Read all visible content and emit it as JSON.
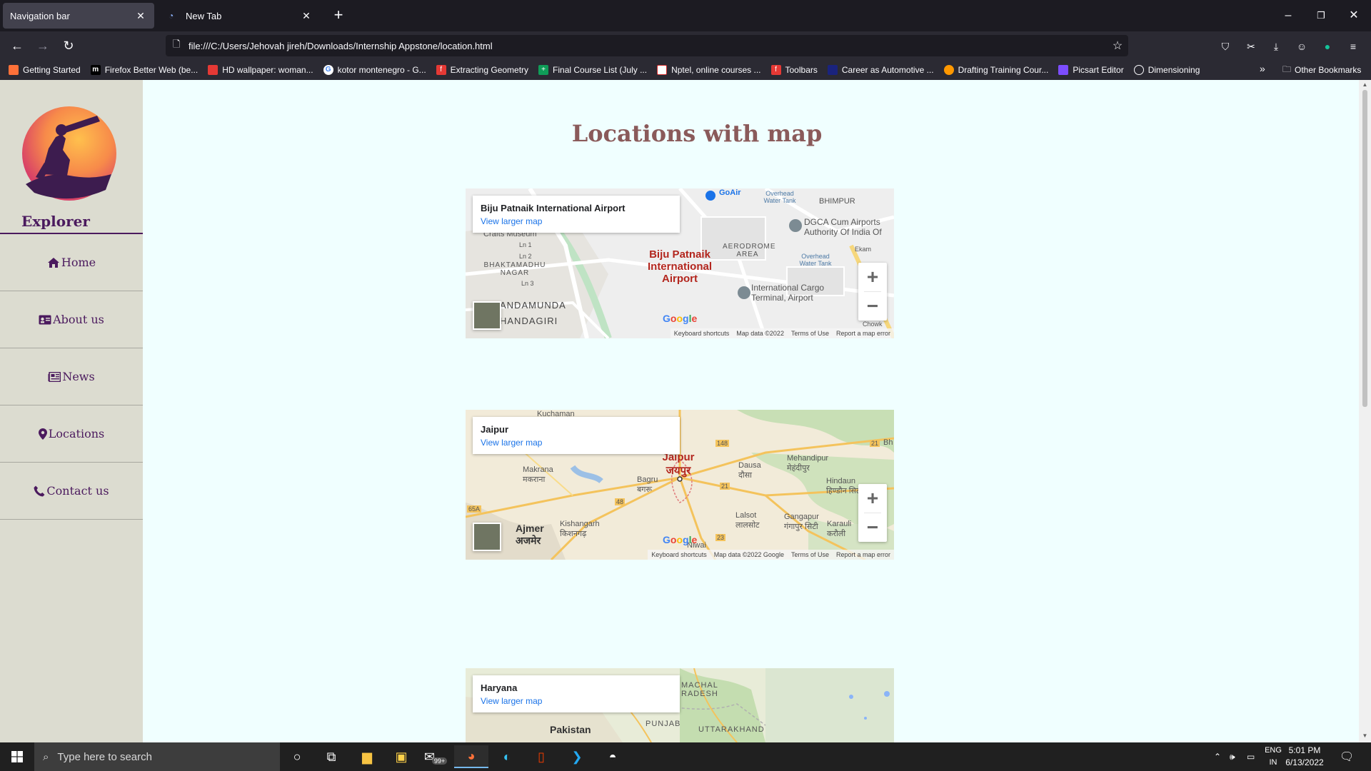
{
  "browser": {
    "tabs": [
      {
        "title": "Navigation bar",
        "active": true
      },
      {
        "title": "New Tab",
        "active": false
      }
    ],
    "url": "file:///C:/Users/Jehovah jireh/Downloads/Internship Appstone/location.html",
    "bookmarks": [
      {
        "label": "Getting Started",
        "color": "#ff7139"
      },
      {
        "label": "Firefox Better Web (be...",
        "color": "#000000"
      },
      {
        "label": "HD wallpaper: woman...",
        "color": "#e53935"
      },
      {
        "label": "kotor montenegro - G...",
        "color": "#4285f4"
      },
      {
        "label": "Extracting Geometry",
        "color": "#e53935"
      },
      {
        "label": "Final Course List (July ...",
        "color": "#0f9d58"
      },
      {
        "label": "Nptel, online courses ...",
        "color": "#d32f2f"
      },
      {
        "label": "Toolbars",
        "color": "#e53935"
      },
      {
        "label": "Career as Automotive ...",
        "color": "#1a237e"
      },
      {
        "label": "Drafting Training Cour...",
        "color": "#ff9800"
      },
      {
        "label": "Picsart Editor",
        "color": "#7c4dff"
      },
      {
        "label": "Dimensioning",
        "color": "#9e9e9e"
      }
    ],
    "other_bookmarks": "Other Bookmarks"
  },
  "sidebar": {
    "brand": "Explorer",
    "items": [
      {
        "label": "Home",
        "icon": "home-icon"
      },
      {
        "label": "About us",
        "icon": "id-card-icon"
      },
      {
        "label": "News",
        "icon": "newspaper-icon"
      },
      {
        "label": "Locations",
        "icon": "map-pin-icon"
      },
      {
        "label": "Contact us",
        "icon": "phone-icon"
      }
    ]
  },
  "page": {
    "title": "Locations with map"
  },
  "maps": [
    {
      "place": "Biju Patnaik International Airport",
      "larger_link": "View larger map",
      "labels": [
        "GoAir",
        "Overhead Water Tank",
        "BHIMPUR",
        "DGCA Cum Airports Authority Of India Of",
        "Crafts Museum",
        "Ln 1",
        "Ln 2",
        "Ln 3",
        "BHAKTAMADHU NAGAR",
        "AERODROME AREA",
        "Overhead Water Tank",
        "Ekam",
        "International Cargo Terminal, Airport",
        "ANDAMUNDA",
        "HANDAGIRI",
        "Chowk"
      ],
      "pin_label": "Biju Patnaik International Airport",
      "attribution": [
        "Keyboard shortcuts",
        "Map data ©2022",
        "Terms of Use",
        "Report a map error"
      ]
    },
    {
      "place": "Jaipur",
      "larger_link": "View larger map",
      "labels": [
        "Kuchaman",
        "Makrana मकराना",
        "Bagru बगरू",
        "Dausa दौसा",
        "Mehandipur मेहंदीपुर",
        "Hindaun हिण्डौन सिटी",
        "Lalsot लालसोट",
        "Gangapur गंगापुर सिटी",
        "Karauli करौली",
        "Kishangarh किशनगढ़",
        "Ajmer अजमेर",
        "Niwai",
        "Bh"
      ],
      "roads": [
        "148",
        "21",
        "21",
        "48",
        "65A",
        "23"
      ],
      "pin_label": "Jaipur जयपुर",
      "attribution": [
        "Keyboard shortcuts",
        "Map data ©2022 Google",
        "Terms of Use",
        "Report a map error"
      ]
    },
    {
      "place": "Haryana",
      "larger_link": "View larger map",
      "labels": [
        "MACHAL RADESH",
        "Pakistan",
        "PUNJAB",
        "UTTARAKHAND"
      ]
    }
  ],
  "taskbar": {
    "search_placeholder": "Type here to search",
    "mail_badge": "99+",
    "lang_top": "ENG",
    "lang_bottom": "IN",
    "time": "5:01 PM",
    "date": "6/13/2022"
  }
}
